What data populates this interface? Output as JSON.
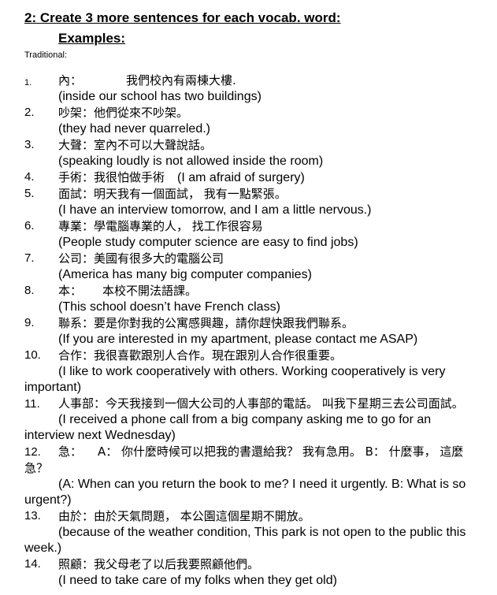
{
  "heading": "2: Create 3 more sentences for each vocab. word:",
  "examples_label": "Examples:",
  "script_label": "Traditional:",
  "entries": [
    {
      "num": "1.",
      "word": "內：",
      "sentence": "我們校內有兩棟大樓.",
      "english": "(inside our school has two buildings)"
    },
    {
      "num": "2.",
      "word": "吵架：",
      "sentence": "他們從來不吵架。",
      "english": "(they had never quarreled.)"
    },
    {
      "num": "3.",
      "word": "大聲：",
      "sentence": "室內不可以大聲說話。",
      "english": "(speaking loudly is not allowed inside the room)"
    },
    {
      "num": "4.",
      "word": "手術：",
      "sentence": "我很怕做手術",
      "english": "(I am afraid of surgery)"
    },
    {
      "num": "5.",
      "word": "面試：",
      "sentence": "明天我有一個面試， 我有一點緊張。",
      "english": "(I have an interview tomorrow, and I am a little nervous.)"
    },
    {
      "num": "6.",
      "word": "專業：",
      "sentence": "學電腦專業的人， 找工作很容易",
      "english": "(People study computer science are easy to find jobs)"
    },
    {
      "num": "7.",
      "word": "公司：",
      "sentence": "美國有很多大的電腦公司",
      "english": "(America has many big computer companies)"
    },
    {
      "num": "8.",
      "word": "本：",
      "sentence": "本校不開法語課。",
      "english": "(This school doesn’t have French class)"
    },
    {
      "num": "9.",
      "word": "聯系：",
      "sentence": "要是你對我的公寓感興趣，請你趕快跟我們聯系。",
      "english": "(If you are interested in my apartment, please contact me ASAP)"
    },
    {
      "num": "10.",
      "word": "合作：",
      "sentence": "我很喜歡跟別人合作。現在跟別人合作很重要。",
      "english": "(I like to work cooperatively with others. Working cooperatively is very important)"
    },
    {
      "num": "11.",
      "word": "人事部：",
      "sentence": "今天我接到一個大公司的人事部的電話。 叫我下星期三去公司面試。",
      "english": "(I received a phone call from a big company asking me to go for an interview next Wednesday)"
    },
    {
      "num": "12.",
      "word": "急：",
      "sentence": "A： 你什麼時候可以把我的書還給我？ 我有急用。 B： 什麼事， 這麼急？",
      "english": "(A: When can you return the book to me? I need it urgently.   B: What is so urgent?)"
    },
    {
      "num": "13.",
      "word": "由於：",
      "sentence": "由於天氣問題， 本公園這個星期不開放。",
      "english": "(because of the weather condition, This park is not open to the public this week.)"
    },
    {
      "num": "14.",
      "word": "照顧：",
      "sentence": "我父母老了以后我要照顧他們。",
      "english": "(I need to take care of my folks when they get old)"
    }
  ]
}
